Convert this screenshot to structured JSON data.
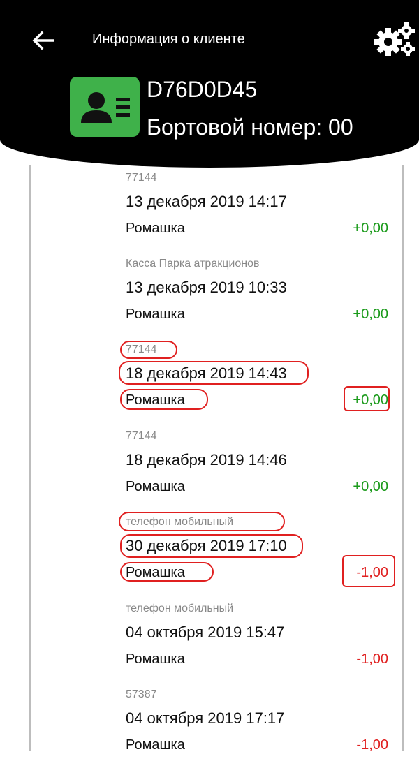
{
  "header": {
    "title": "Информация о клиенте",
    "client_id": "D76D0D45",
    "board_number": "Бортовой номер: 00"
  },
  "icons": {
    "back": "arrow-left-icon",
    "settings": "gears-icon",
    "client": "id-card-icon"
  },
  "colors": {
    "header_bg": "#000000",
    "avatar_bg": "#3fb14a",
    "positive": "#1a9a1a",
    "negative": "#e02020",
    "highlight": "#e02020"
  },
  "transactions": [
    {
      "source": "77144",
      "date": "13 декабря 2019 14:17",
      "name": "Ромашка",
      "amount": "+0,00"
    },
    {
      "source": "Касса Парка атракционов",
      "date": "13 декабря 2019 10:33",
      "name": "Ромашка",
      "amount": "+0,00"
    },
    {
      "source": "77144",
      "date": "18 декабря 2019 14:43",
      "name": "Ромашка",
      "amount": "+0,00"
    },
    {
      "source": "77144",
      "date": "18 декабря 2019 14:46",
      "name": "Ромашка",
      "amount": "+0,00"
    },
    {
      "source": "телефон мобильный",
      "date": "30 декабря 2019 17:10",
      "name": "Ромашка",
      "amount": "-1,00"
    },
    {
      "source": "телефон мобильный",
      "date": "04 октября 2019 15:47",
      "name": "Ромашка",
      "amount": "-1,00"
    },
    {
      "source": "57387",
      "date": "04 октября 2019 17:17",
      "name": "Ромашка",
      "amount": "-1,00"
    }
  ]
}
